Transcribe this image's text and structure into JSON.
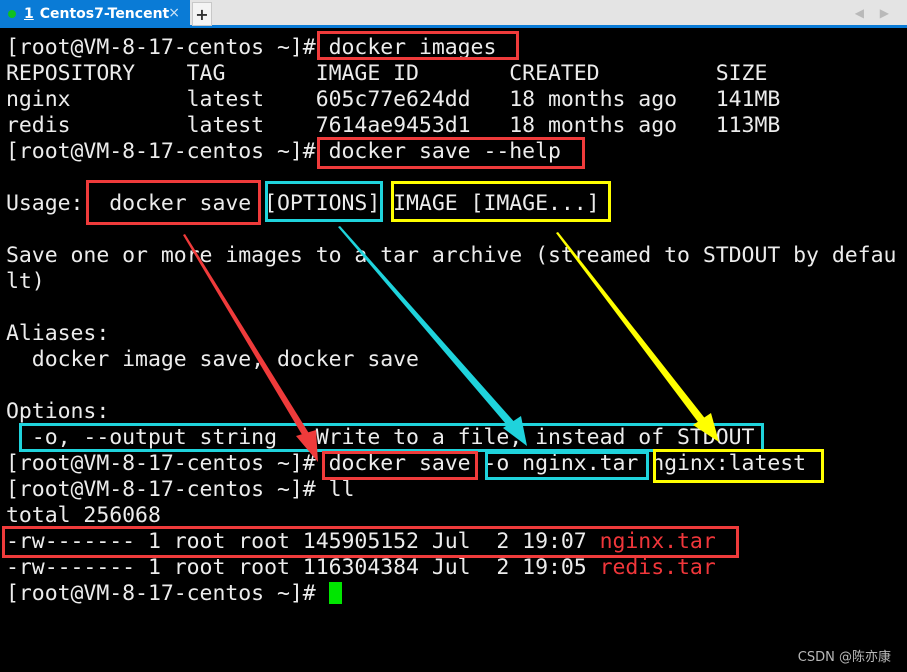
{
  "window": {
    "tab": {
      "number": "1",
      "title": "Centos7-Tencent",
      "status_color": "#10c020",
      "close_glyph": "×"
    },
    "new_tab_glyph": "+",
    "nav_arrows": "◀ ▶"
  },
  "terminal": {
    "prompt": "[root@VM-8-17-centos ~]# ",
    "lines": [
      {
        "type": "command",
        "command": "docker images"
      },
      {
        "type": "output",
        "text": "REPOSITORY    TAG       IMAGE ID       CREATED         SIZE"
      },
      {
        "type": "output",
        "text": "nginx         latest    605c77e624dd   18 months ago   141MB"
      },
      {
        "type": "output",
        "text": "redis         latest    7614ae9453d1   18 months ago   113MB"
      },
      {
        "type": "command",
        "command": "docker save --help"
      },
      {
        "type": "output",
        "text": ""
      },
      {
        "type": "output",
        "text": "Usage:  docker save [OPTIONS] IMAGE [IMAGE...]"
      },
      {
        "type": "output",
        "text": ""
      },
      {
        "type": "output",
        "text": "Save one or more images to a tar archive (streamed to STDOUT by defau"
      },
      {
        "type": "output",
        "text": "lt)"
      },
      {
        "type": "output",
        "text": ""
      },
      {
        "type": "output",
        "text": "Aliases:"
      },
      {
        "type": "output",
        "text": "  docker image save, docker save"
      },
      {
        "type": "output",
        "text": ""
      },
      {
        "type": "output",
        "text": "Options:"
      },
      {
        "type": "output",
        "text": "  -o, --output string   Write to a file, instead of STDOUT"
      },
      {
        "type": "command",
        "command": "docker save -o nginx.tar nginx:latest"
      },
      {
        "type": "command",
        "command": "ll"
      },
      {
        "type": "output",
        "text": "total 256068"
      },
      {
        "type": "file",
        "text": "-rw------- 1 root root 145905152 Jul  2 19:07 ",
        "filename": "nginx.tar"
      },
      {
        "type": "file",
        "text": "-rw------- 1 root root 116304384 Jul  2 19:05 ",
        "filename": "redis.tar"
      },
      {
        "type": "prompt",
        "command": ""
      }
    ],
    "colors": {
      "text": "#ececec",
      "background": "#000000",
      "archive_file": "#f0363a",
      "cursor": "#00e600"
    }
  },
  "annotations": {
    "colors": {
      "red": "#ef3b3b",
      "cyan": "#1fd3dc",
      "yellow": "#ffff00"
    },
    "boxes": [
      {
        "color": "red",
        "label": "docker images"
      },
      {
        "color": "red",
        "label": "docker save --help"
      },
      {
        "color": "red",
        "label": "docker save"
      },
      {
        "color": "cyan",
        "label": "[OPTIONS]"
      },
      {
        "color": "yellow",
        "label": "IMAGE [IMAGE...]"
      },
      {
        "color": "cyan",
        "label": "-o, --output string   Write to a file, instead of STDOUT"
      },
      {
        "color": "red",
        "label": "docker save"
      },
      {
        "color": "cyan",
        "label": "-o nginx.tar"
      },
      {
        "color": "yellow",
        "label": "nginx:latest"
      },
      {
        "color": "red",
        "label": "nginx.tar listing"
      }
    ],
    "arrows": [
      {
        "color": "red",
        "from": "docker save (usage)",
        "to": "docker save (command)"
      },
      {
        "color": "cyan",
        "from": "[OPTIONS]",
        "to": "-o option description"
      },
      {
        "color": "yellow",
        "from": "IMAGE [IMAGE...]",
        "to": "nginx:latest"
      }
    ]
  },
  "watermark": "CSDN @陈亦康"
}
